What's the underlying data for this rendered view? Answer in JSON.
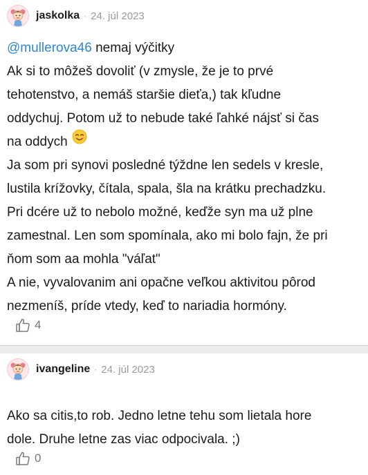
{
  "comments": [
    {
      "username": "jaskolka",
      "date": "24. júl 2023",
      "mention": "@mullerova46",
      "lines": [
        " nemaj výčitky",
        "Ak si to môžeš dovoliť (v zmysle, že je to prvé",
        "tehotenstvo, a nemáš staršie dieťa,) tak kľudne",
        "oddychuj. Potom už to nebude také ľahké nájsť si čas",
        "na oddych",
        "Ja som pri synovi posledné týždne len sedels v kresle,",
        "lustila krížovky, čítala, spala, šla na krátku prechadzku.",
        "Pri dcére už to nebolo možné, keďže syn ma už plne",
        "zamestnal. Len som spomínala, ako mi bolo fajn, že pri",
        "ňom som aa mohla \"váľat\"",
        "A nie, vyvalovanim ani opačne veľkou aktivitou pôrod",
        "nezmeníš, príde vtedy, keď to nariadia hormóny."
      ],
      "emoji": "smiling-face-icon",
      "likes": "4"
    },
    {
      "username": "ivangeline",
      "date": "24. júl 2023",
      "lines": [
        "Ako sa citis,to rob. Jedno letne tehu som lietala hore",
        "dole. Druhe letne zas viac odpocivala. ;)"
      ],
      "likes": "0"
    }
  ],
  "separator": "·",
  "colors": {
    "mention": "#2f86cf",
    "meta": "#9a9a9a",
    "divider": "#ececec",
    "avatar_bg": "#fde7ea"
  }
}
